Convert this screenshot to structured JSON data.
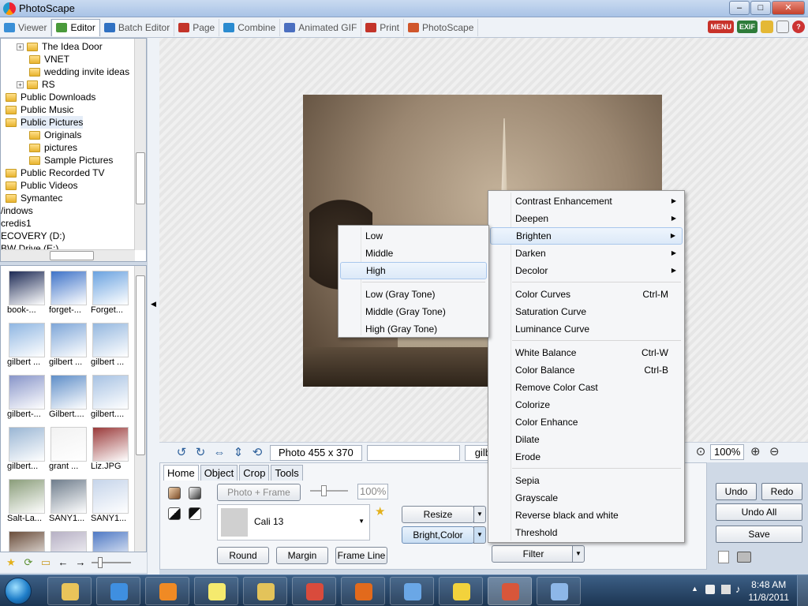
{
  "window": {
    "title": "PhotoScape",
    "minimize": "–",
    "maximize": "□",
    "close": "✕"
  },
  "tabs": [
    {
      "label": "Viewer",
      "icon": "viewer-icon",
      "active": false
    },
    {
      "label": "Editor",
      "icon": "editor-icon",
      "active": true
    },
    {
      "label": "Batch Editor",
      "icon": "batch-editor-icon",
      "active": false
    },
    {
      "label": "Page",
      "icon": "page-icon",
      "active": false
    },
    {
      "label": "Combine",
      "icon": "combine-icon",
      "active": false
    },
    {
      "label": "Animated GIF",
      "icon": "gif-icon",
      "active": false
    },
    {
      "label": "Print",
      "icon": "print-icon",
      "active": false
    },
    {
      "label": "PhotoScape",
      "icon": "photoscape-icon",
      "active": false
    }
  ],
  "badges": {
    "menu": "MENU",
    "exif": "EXIF"
  },
  "tree": [
    {
      "label": "The Idea Door",
      "expander": "+"
    },
    {
      "label": "VNET",
      "expander": ""
    },
    {
      "label": "wedding invite ideas",
      "expander": ""
    },
    {
      "label": "RS",
      "expander": "+"
    },
    {
      "label": "Public Downloads",
      "expander": ""
    },
    {
      "label": "Public Music",
      "expander": ""
    },
    {
      "label": "Public Pictures",
      "expander": ""
    },
    {
      "label": "Originals",
      "expander": ""
    },
    {
      "label": "pictures",
      "expander": ""
    },
    {
      "label": "Sample Pictures",
      "expander": ""
    },
    {
      "label": "Public Recorded TV",
      "expander": ""
    },
    {
      "label": "Public Videos",
      "expander": ""
    },
    {
      "label": "Symantec",
      "expander": ""
    },
    {
      "label": "/indows",
      "expander": ""
    },
    {
      "label": "credis1",
      "expander": ""
    },
    {
      "label": "ECOVERY (D:)",
      "expander": ""
    },
    {
      "label": "BW Drive (E:)",
      "expander": ""
    }
  ],
  "thumbnails": [
    "book-...",
    "forget-...",
    "Forget...",
    "gilbert ...",
    "gilbert ...",
    "gilbert ...",
    "gilbert-...",
    "Gilbert....",
    "gilbert....",
    "gilbert...",
    "grant ...",
    "Liz.JPG",
    "Salt-La...",
    "SANY1...",
    "SANY1..."
  ],
  "thumb_colors": [
    "#1d2a55",
    "#3e73c8",
    "#6aa2e0",
    "#8fb6e2",
    "#7ea6d8",
    "#94b7df",
    "#8895c9",
    "#5f8ec8",
    "#a7c2e3",
    "#9ab6d4",
    "#f2f2f2",
    "#9a3a3a",
    "#8a9d7a",
    "#6f7d8c",
    "#c5d4ea",
    "#6a4d3a",
    "#b6b0c4",
    "#4f79c4"
  ],
  "status": {
    "photo_size": "Photo 455 x 370",
    "file": "gilb",
    "zoom": "100%"
  },
  "panel": {
    "tabs": [
      "Home",
      "Object",
      "Crop",
      "Tools"
    ],
    "photo_frame": "Photo + Frame",
    "opacity": "100%",
    "font": "Cali 13",
    "round": "Round",
    "margin": "Margin",
    "frame_line": "Frame Line",
    "resize": "Resize",
    "bright_color": "Bright,Color",
    "filter": "Filter"
  },
  "actions": {
    "undo": "Undo",
    "redo": "Redo",
    "undo_all": "Undo All",
    "save": "Save"
  },
  "filter_menu": [
    {
      "label": "Contrast Enhancement",
      "key": "",
      "arrow": "▶"
    },
    {
      "label": "Deepen",
      "key": "",
      "arrow": "▶"
    },
    {
      "label": "Brighten",
      "key": "",
      "arrow": "▶"
    },
    {
      "label": "Darken",
      "key": "",
      "arrow": "▶"
    },
    {
      "label": "Decolor",
      "key": "",
      "arrow": "▶"
    },
    {
      "label": "Color Curves",
      "key": "Ctrl-M",
      "arrow": ""
    },
    {
      "label": "Saturation Curve",
      "key": "",
      "arrow": ""
    },
    {
      "label": "Luminance Curve",
      "key": "",
      "arrow": ""
    },
    {
      "label": "White Balance",
      "key": "Ctrl-W",
      "arrow": ""
    },
    {
      "label": "Color Balance",
      "key": "Ctrl-B",
      "arrow": ""
    },
    {
      "label": "Remove Color Cast",
      "key": "",
      "arrow": ""
    },
    {
      "label": "Colorize",
      "key": "",
      "arrow": ""
    },
    {
      "label": "Color Enhance",
      "key": "",
      "arrow": ""
    },
    {
      "label": "Dilate",
      "key": "",
      "arrow": ""
    },
    {
      "label": "Erode",
      "key": "",
      "arrow": ""
    },
    {
      "label": "Sepia",
      "key": "",
      "arrow": ""
    },
    {
      "label": "Grayscale",
      "key": "",
      "arrow": ""
    },
    {
      "label": "Reverse black and white",
      "key": "",
      "arrow": ""
    },
    {
      "label": "Threshold",
      "key": "",
      "arrow": ""
    }
  ],
  "brighten_menu": [
    {
      "label": "Low"
    },
    {
      "label": "Middle"
    },
    {
      "label": "High"
    },
    {
      "label": "Low (Gray Tone)"
    },
    {
      "label": "Middle (Gray Tone)"
    },
    {
      "label": "High (Gray Tone)"
    }
  ],
  "taskbar_apps": [
    {
      "icon": "explorer-icon",
      "color": "#e9c45a"
    },
    {
      "icon": "internet-explorer-icon",
      "color": "#3f8fe0"
    },
    {
      "icon": "media-player-icon",
      "color": "#f08a24"
    },
    {
      "icon": "sticky-notes-icon",
      "color": "#f5ea6e"
    },
    {
      "icon": "outlook-icon",
      "color": "#e3c35a"
    },
    {
      "icon": "chrome-icon",
      "color": "#d94b3c"
    },
    {
      "icon": "firefox-icon",
      "color": "#e26a1c"
    },
    {
      "icon": "safari-icon",
      "color": "#6aa7e6"
    },
    {
      "icon": "star-app-icon",
      "color": "#f2d23c"
    },
    {
      "icon": "photoscape-icon",
      "color": "#d8563a"
    },
    {
      "icon": "paint-icon",
      "color": "#8db7e8"
    }
  ],
  "clock": {
    "time": "8:48 AM",
    "date": "11/8/2011"
  },
  "colors": {
    "accent": "#2c5f9a",
    "menu_highlight": "#dce9f8",
    "title_bar": "#b8cde9",
    "taskbar": "#2a4668"
  }
}
